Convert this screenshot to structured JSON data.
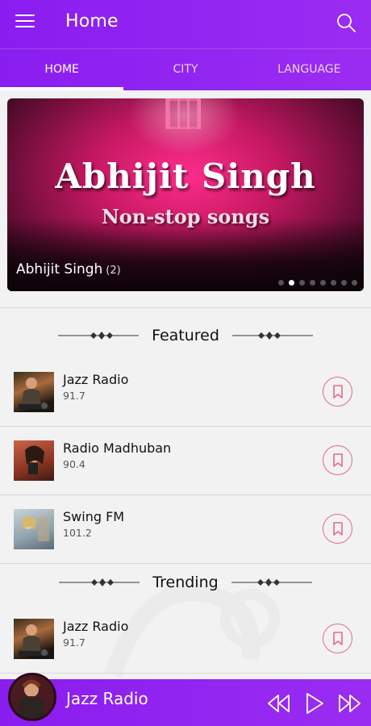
{
  "header": {
    "title": "Home"
  },
  "tabs": [
    {
      "label": "HOME",
      "active": true
    },
    {
      "label": "CITY",
      "active": false
    },
    {
      "label": "LANGUAGE",
      "active": false
    }
  ],
  "banner": {
    "headline": "Abhijit Singh",
    "subheadline": "Non-stop songs",
    "caption": "Abhijit Singh",
    "count": "(2)",
    "slide_count": 8,
    "active_slide": 2
  },
  "sections": {
    "featured": "Featured",
    "trending": "Trending"
  },
  "featured": [
    {
      "name": "Jazz Radio",
      "freq": "91.7"
    },
    {
      "name": "Radio Madhuban",
      "freq": "90.4"
    },
    {
      "name": "Swing FM",
      "freq": "101.2"
    }
  ],
  "trending": [
    {
      "name": "Jazz Radio",
      "freq": "91.7"
    }
  ],
  "player": {
    "title": "Jazz Radio"
  },
  "colors": {
    "accent": "#8a1df0",
    "bookmark": "#e36a8a"
  },
  "icons": [
    "menu-icon",
    "search-icon",
    "bookmark-icon",
    "rewind-icon",
    "play-icon",
    "fast-forward-icon"
  ]
}
